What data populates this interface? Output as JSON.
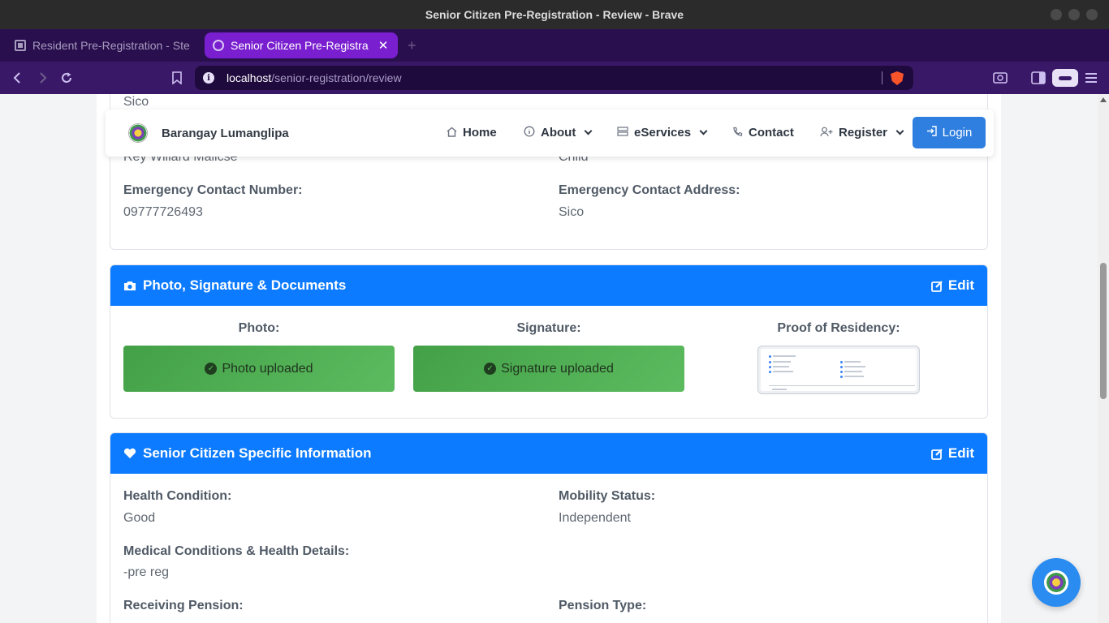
{
  "window": {
    "title": "Senior Citizen Pre-Registration - Review - Brave"
  },
  "tabs": [
    {
      "label": "Resident Pre-Registration - Ste",
      "active": false
    },
    {
      "label": "Senior Citizen Pre-Registra",
      "active": true
    }
  ],
  "toolbar": {
    "url_host": "localhost",
    "url_path": "/senior-registration/review"
  },
  "navbar": {
    "brand": "Barangay Lumanglipa",
    "items": [
      "Home",
      "About",
      "eServices",
      "Contact",
      "Register"
    ],
    "login": "Login"
  },
  "emergency": {
    "partial_value": "Sico",
    "name_value": "Rey Willard Malicse",
    "relationship_value": "Child",
    "number_label": "Emergency Contact Number:",
    "number_value": "09777726493",
    "address_label": "Emergency Contact Address:",
    "address_value": "Sico"
  },
  "photo_section": {
    "title": "Photo, Signature & Documents",
    "edit": "Edit",
    "photo_label": "Photo:",
    "photo_status": "Photo uploaded",
    "signature_label": "Signature:",
    "signature_status": "Signature uploaded",
    "residency_label": "Proof of Residency:"
  },
  "senior_section": {
    "title": "Senior Citizen Specific Information",
    "edit": "Edit",
    "health_label": "Health Condition:",
    "health_value": "Good",
    "mobility_label": "Mobility Status:",
    "mobility_value": "Independent",
    "medical_label": "Medical Conditions & Health Details:",
    "medical_value": "-pre reg",
    "pension_label": "Receiving Pension:",
    "pension_type_label": "Pension Type:"
  },
  "colors": {
    "card_header": "#0d7bff",
    "upload_green": "#4caf50",
    "login_button": "#2f7fe0",
    "tab_active": "#7a1fd0",
    "browser_frame": "#3a1868"
  }
}
